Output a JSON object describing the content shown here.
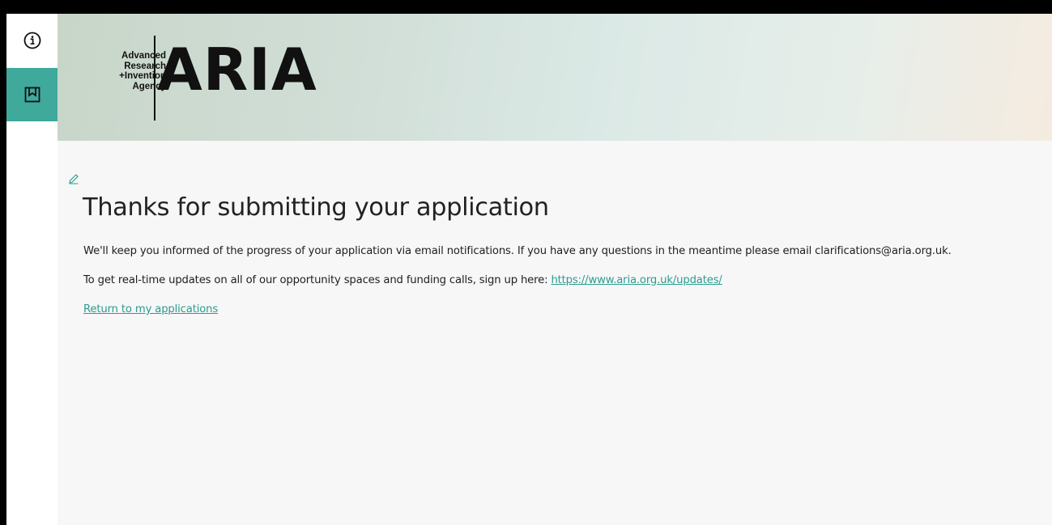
{
  "sidebar": {
    "info_icon": "info-circle-icon",
    "bookmark_icon": "bookmark-icon"
  },
  "brand": {
    "logo_small_lines": [
      "Advanced",
      "Research",
      "+Invention",
      "Agency"
    ],
    "logo_big": "ARIA"
  },
  "content": {
    "edit_icon": "pencil-icon",
    "title": "Thanks for submitting your application",
    "paragraph1": "We'll keep you informed of the progress of your application via email notifications. If you have any questions in the meantime please email clarifications@aria.org.uk.",
    "paragraph2_prefix": "To get real-time updates on all of our opportunity spaces and funding calls, sign up here:",
    "updates_link": "https://www.aria.org.uk/updates/",
    "return_link": "Return to my applications"
  },
  "colors": {
    "accent": "#3fa99c",
    "link": "#2a9d8f"
  }
}
